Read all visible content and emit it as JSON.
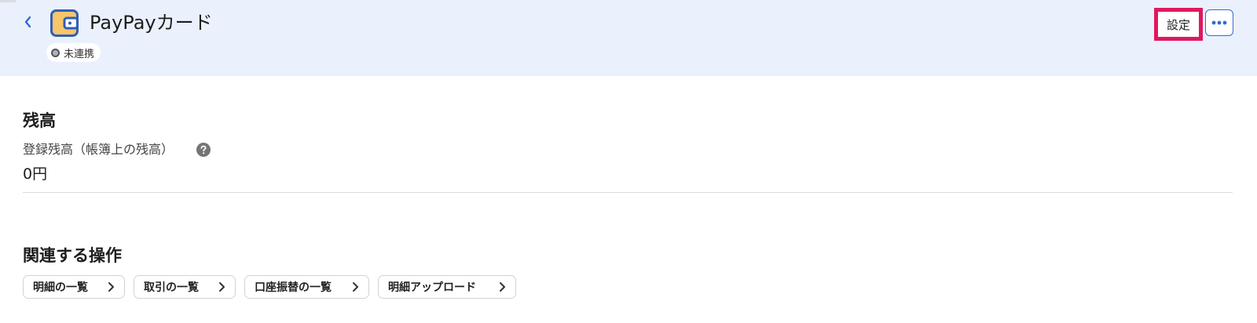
{
  "header": {
    "title": "PayPayカード",
    "status": "未連携",
    "settings_label": "設定",
    "icons": {
      "back": "chevron-left-icon",
      "app": "wallet-icon",
      "more": "more-horizontal-icon"
    },
    "colors": {
      "background": "#eaf1fd",
      "accent": "#2f6bd6",
      "highlight_border": "#e0185e",
      "app_icon_fill": "#f7c56a"
    }
  },
  "balance": {
    "section_title": "残高",
    "label": "登録残高（帳簿上の残高）",
    "help_icon": "question-circle-icon",
    "value": "0円"
  },
  "related": {
    "section_title": "関連する操作",
    "actions": [
      {
        "label": "明細の一覧"
      },
      {
        "label": "取引の一覧"
      },
      {
        "label": "口座振替の一覧"
      },
      {
        "label": "明細アップロード"
      }
    ]
  }
}
